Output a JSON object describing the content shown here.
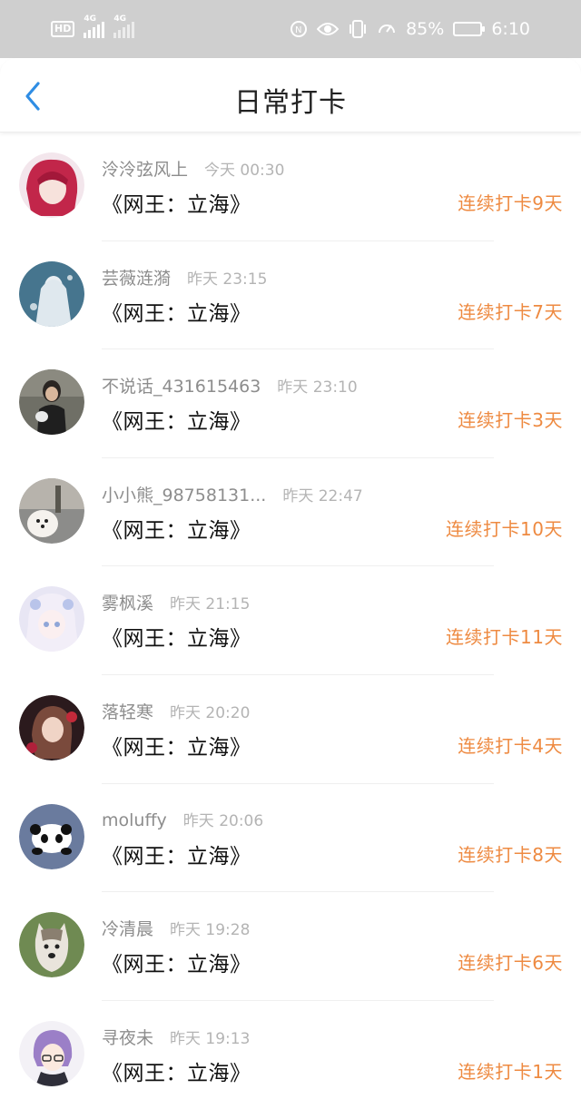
{
  "status_bar": {
    "hd": "HD",
    "net1": "4G",
    "net2": "4G",
    "battery_text": "85%",
    "battery_level": 0.85,
    "clock": "6:10",
    "icons": [
      "nfc-icon",
      "eye-icon",
      "vibrate-icon",
      "speed-icon",
      "battery-icon"
    ]
  },
  "header": {
    "back_icon": "chevron-left-icon",
    "title": "日常打卡",
    "accent_color": "#2f8de4"
  },
  "colors": {
    "streak": "#ee8a41",
    "username": "#8d8d8d",
    "time": "#b4b4b4"
  },
  "checkins": [
    {
      "username": "泠泠弦风上",
      "time": "今天 00:30",
      "book": "《网王：立海》",
      "streak": "连续打卡9天",
      "avatar": "red-haired-girl"
    },
    {
      "username": "芸薇涟漪",
      "time": "昨天 23:15",
      "book": "《网王：立海》",
      "streak": "连续打卡7天",
      "avatar": "white-haired-figure"
    },
    {
      "username": "不说话_431615463",
      "time": "昨天 23:10",
      "book": "《网王：立海》",
      "streak": "连续打卡3天",
      "avatar": "person-photo"
    },
    {
      "username": "小小熊_98758131...",
      "time": "昨天 22:47",
      "book": "《网王：立海》",
      "streak": "连续打卡10天",
      "avatar": "white-puppy"
    },
    {
      "username": "雾枫溪",
      "time": "昨天 21:15",
      "book": "《网王：立海》",
      "streak": "连续打卡11天",
      "avatar": "pastel-anime-girl"
    },
    {
      "username": "落轻寒",
      "time": "昨天 20:20",
      "book": "《网王：立海》",
      "streak": "连续打卡4天",
      "avatar": "dark-anime-girl"
    },
    {
      "username": "moluffy",
      "time": "昨天 20:06",
      "book": "《网王：立海》",
      "streak": "连续打卡8天",
      "avatar": "panda"
    },
    {
      "username": "冷清晨",
      "time": "昨天 19:28",
      "book": "《网王：立海》",
      "streak": "连续打卡6天",
      "avatar": "husky-puppy"
    },
    {
      "username": "寻夜未",
      "time": "昨天 19:13",
      "book": "《网王：立海》",
      "streak": "连续打卡1天",
      "avatar": "purple-haired-boy"
    }
  ]
}
